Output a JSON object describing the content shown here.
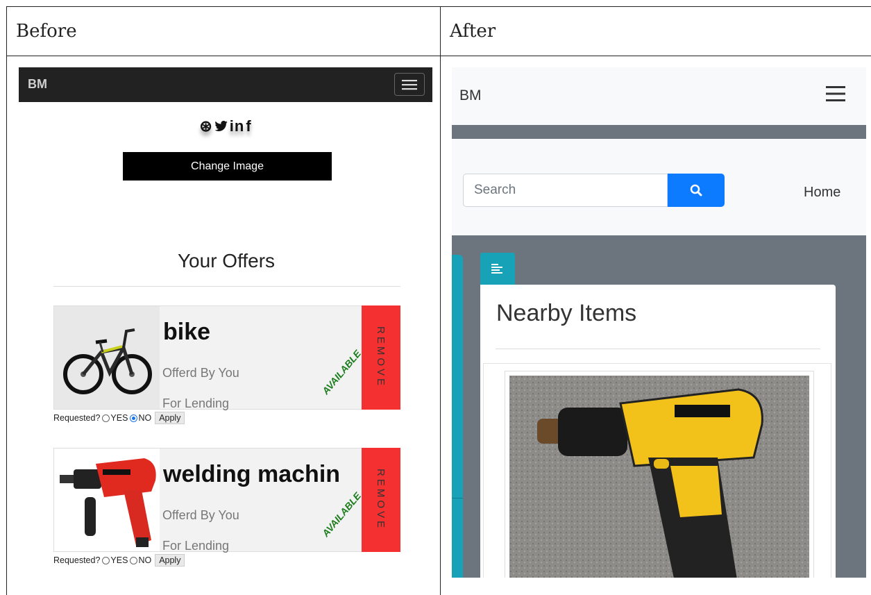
{
  "headers": {
    "before": "Before",
    "after": "After"
  },
  "before": {
    "navbar": {
      "brand": "BM"
    },
    "social_icons": [
      "dribbble-icon",
      "twitter-icon",
      "linkedin-icon",
      "facebook-icon"
    ],
    "change_image_label": "Change Image",
    "offers_title": "Your Offers",
    "offers": [
      {
        "name": "bike",
        "offered_by": "Offerd By You",
        "type": "For Lending",
        "status": "AVAILABLE",
        "remove_label": "REMOVE",
        "requested_label": "Requested?",
        "yes_label": "YES",
        "no_label": "NO",
        "selected": "NO",
        "apply_label": "Apply"
      },
      {
        "name": "welding machin",
        "offered_by": "Offerd By You",
        "type": "For Lending",
        "status": "AVAILABLE",
        "remove_label": "REMOVE",
        "requested_label": "Requested?",
        "yes_label": "YES",
        "no_label": "NO",
        "selected": "",
        "apply_label": "Apply"
      }
    ],
    "colors": {
      "navbar": "#222222",
      "remove": "#f43030",
      "available": "#1e7d1e"
    }
  },
  "after": {
    "navbar": {
      "brand": "BM"
    },
    "search": {
      "placeholder": "Search"
    },
    "nav_link_home": "Home",
    "section_title": "Nearby Items",
    "colors": {
      "primary": "#0d7bff",
      "info": "#17a2b8",
      "secondary": "#6c757d"
    }
  }
}
